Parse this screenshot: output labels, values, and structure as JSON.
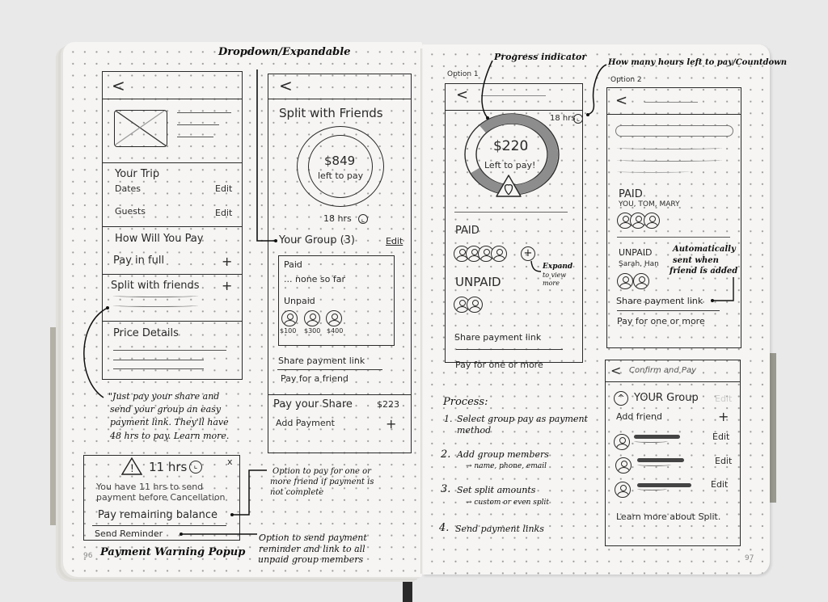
{
  "annotations": {
    "dropdown": "Dropdown/Expandable",
    "progress": "Progress indicator",
    "countdown": "How many hours left to pay/Countdown",
    "option1": "Option 1",
    "option2": "Option 2",
    "expand": [
      "Expand",
      "to view",
      "more"
    ],
    "auto_sent": [
      "Automatically",
      "sent when",
      "friend is added"
    ],
    "quote": [
      "\"Just pay your share and",
      "send your group an easy",
      "payment link. They'll have",
      "48 hrs to pay. Learn more."
    ],
    "pay_option": [
      "Option to pay for one or",
      "more friend if payment is",
      "not complete"
    ],
    "reminder_option": [
      "Option to send payment",
      "reminder and link to all",
      "unpaid group members"
    ],
    "popup_caption": "Payment Warning Popup"
  },
  "page_numbers": {
    "left": "96",
    "right": "97"
  },
  "screen1": {
    "back": "<",
    "your_trip": "Your Trip",
    "dates": "Dates",
    "guests": "Guests",
    "edit": "Edit",
    "how_pay": "How Will You Pay",
    "pay_full": "Pay in full",
    "split": "Split with friends",
    "plus": "+",
    "price_details": "Price Details"
  },
  "screen2": {
    "back": "<",
    "title": "Split with Friends",
    "amount": "$849",
    "left_to_pay": "left to pay",
    "hours": "18 hrs",
    "group": "Your Group (3)",
    "edit": "Edit",
    "paid": "Paid",
    "none_so_far": "... none so far",
    "unpaid": "Unpaid",
    "amounts": [
      "$100",
      "$300",
      "$400"
    ],
    "share_link": "Share payment link",
    "pay_friend": "Pay for a friend",
    "pay_share": "Pay your Share",
    "share_amount": "$223",
    "add_payment": "Add Payment",
    "plus": "+"
  },
  "popup": {
    "hours": "11 hrs",
    "close": "x",
    "warning_icon": "!",
    "message": [
      "You have 11 hrs to send",
      "payment before Cancellation"
    ],
    "pay_remaining": "Pay remaining balance",
    "send_reminder": "Send Reminder"
  },
  "screen3": {
    "back": "<",
    "hours": "18 hrs",
    "amount": "$220",
    "left_to_pay": "Left to pay!",
    "progress_fraction": 0.8,
    "paid": "PAID",
    "unpaid": "UNPAID",
    "share_link": "Share payment link",
    "pay_more": "Pay for one or more",
    "plus": "+"
  },
  "screen4": {
    "back": "<",
    "paid": "PAID",
    "paid_names": "YOU, TOM, MARY",
    "unpaid": "UNPAID",
    "unpaid_names": "Sarah, Han",
    "share_link": "Share payment link",
    "pay_more": "Pay for one or more"
  },
  "screen5": {
    "back": "<",
    "title": "Confirm and Pay",
    "group": "YOUR Group",
    "add_friend": "Add friend",
    "plus": "+",
    "edit": "Edit",
    "learn_more": "Learn more about Split."
  },
  "process": {
    "title": "Process:",
    "steps": [
      {
        "num": "1.",
        "text": "Select group pay as payment",
        "sub": "method"
      },
      {
        "num": "2.",
        "text": "Add group members",
        "sub": "→ name, phone, email"
      },
      {
        "num": "3.",
        "text": "Set split amounts",
        "sub": "→ custom or even split"
      },
      {
        "num": "4.",
        "text": "Send payment links",
        "sub": ""
      }
    ]
  }
}
